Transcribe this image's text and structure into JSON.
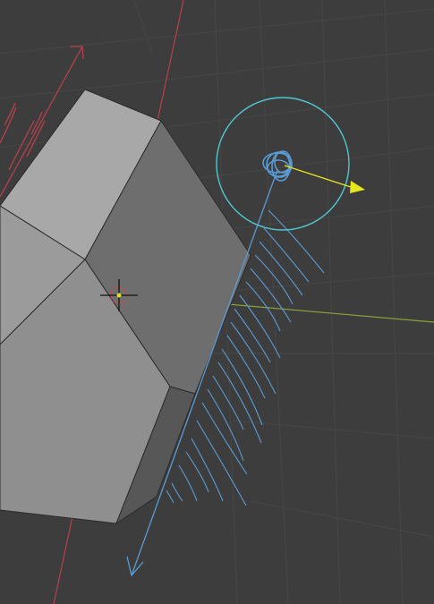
{
  "viewport": {
    "background": "#3d3d3d",
    "grid_color": "#4a4a4a"
  },
  "colors": {
    "x_axis": "#b8414a",
    "y_axis": "#8aa53a",
    "light_blue": "#5a9bd4",
    "light_circle": "#4fc7d1",
    "light_arrow": "#e6e61e",
    "mesh_top": "#a7a7a7",
    "mesh_left": "#959595",
    "mesh_front": "#8f8f8f",
    "mesh_side": "#6f6f6f",
    "mesh_shadow": "#505050",
    "mesh_edge": "#2b2b2b"
  },
  "icons": {
    "light": "area-light-icon",
    "light_arrow": "light-direction-arrow-icon",
    "cursor": "3d-cursor-icon",
    "object_arrow": "object-direction-arrow-icon"
  }
}
